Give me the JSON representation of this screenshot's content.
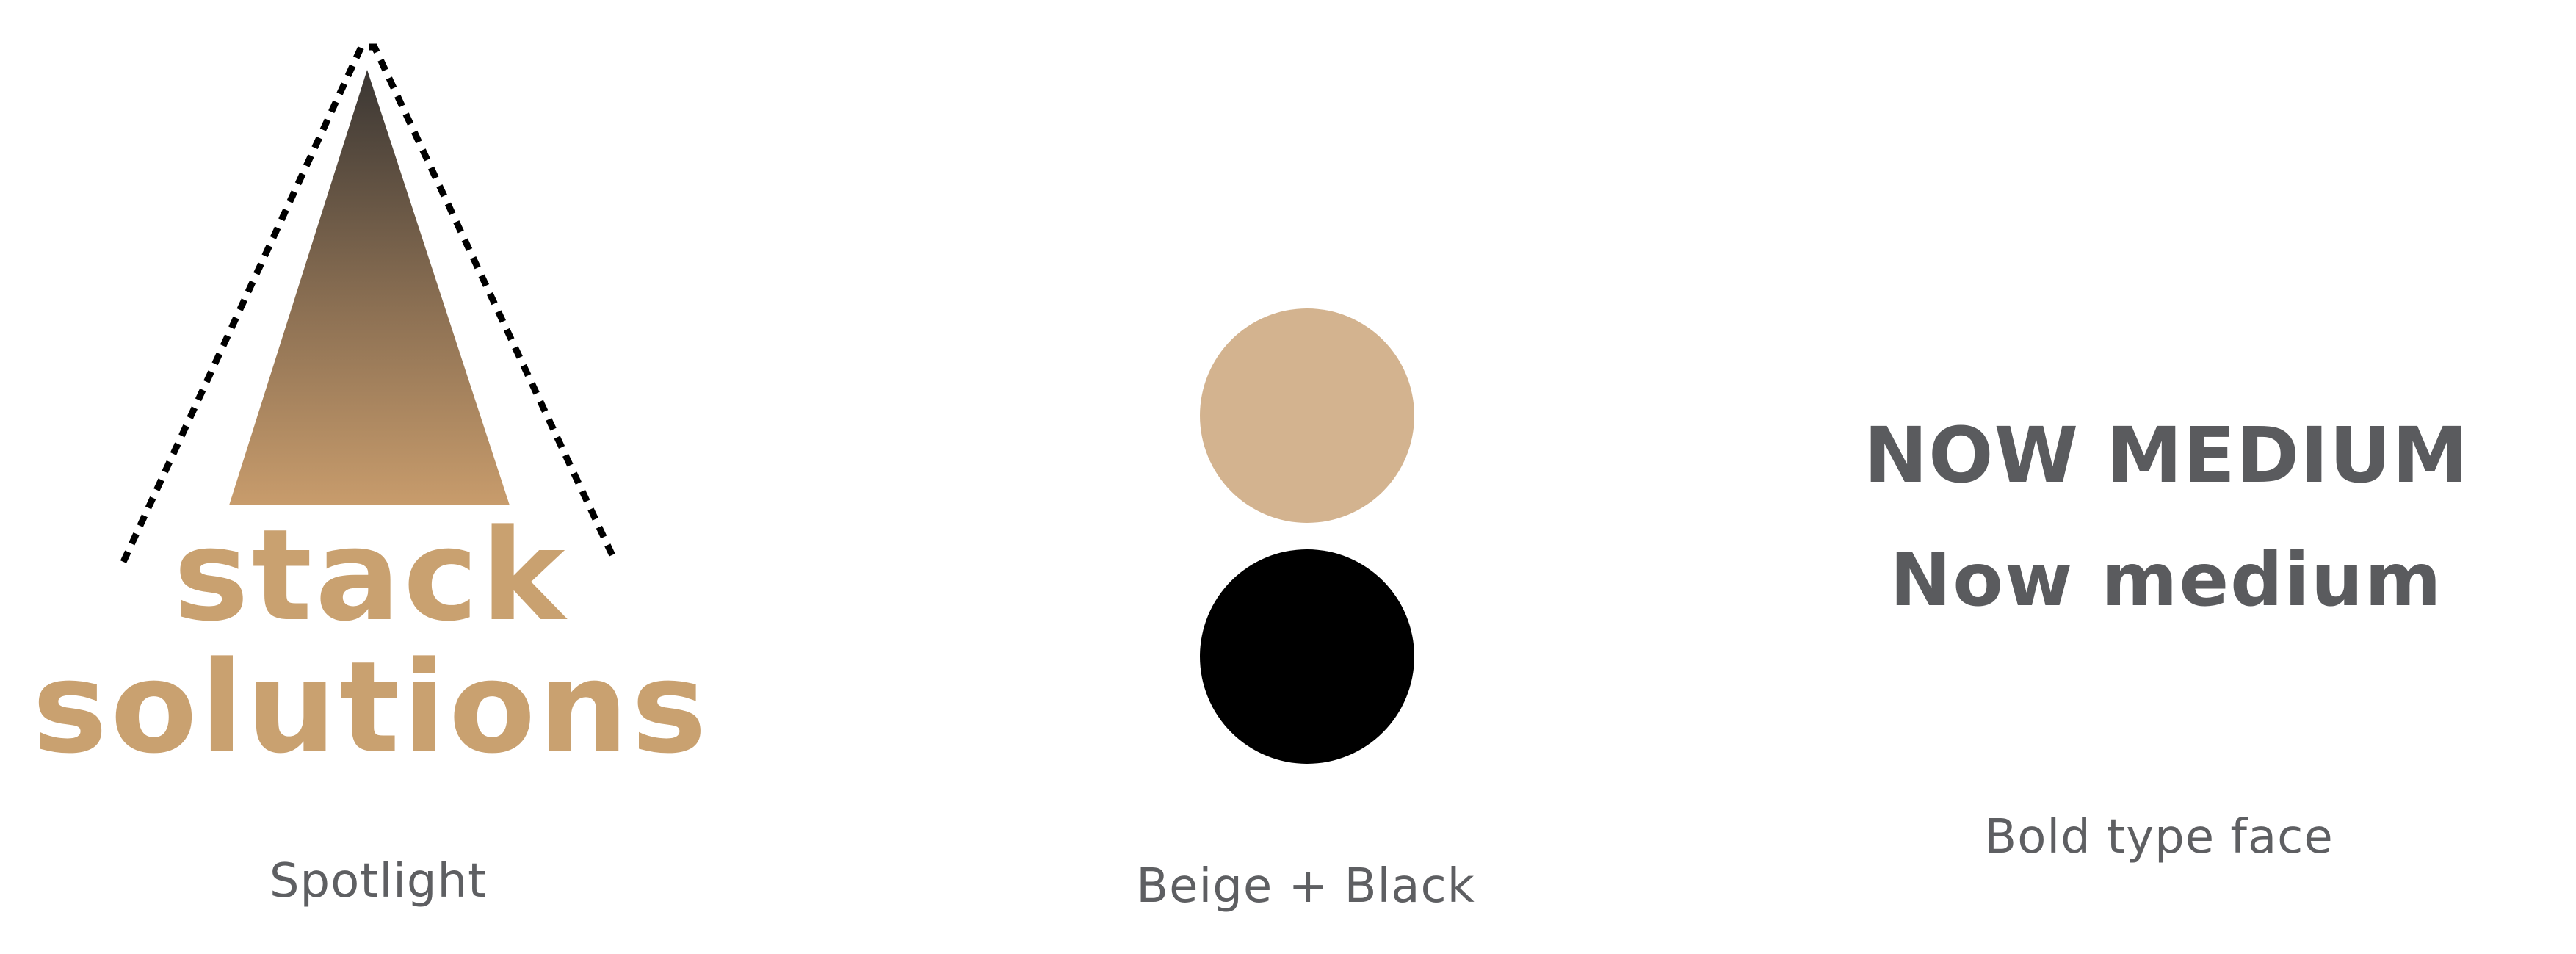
{
  "logo": {
    "line1": "stack",
    "line2": "solutions",
    "text_color": "#C9A170",
    "gradient_top": "#3A3633",
    "gradient_bottom": "#C89C6C",
    "dash_color": "#000000"
  },
  "palette": {
    "beige": "#D3B38F",
    "black": "#000000"
  },
  "typography": {
    "sample_upper": "NOW MEDIUM",
    "sample_mixed": "Now medium",
    "color": "#5A5B5E"
  },
  "captions": {
    "spotlight": "Spotlight",
    "beige_black": "Beige + Black",
    "bold_type_face": "Bold type face",
    "color": "#5E5F62"
  }
}
